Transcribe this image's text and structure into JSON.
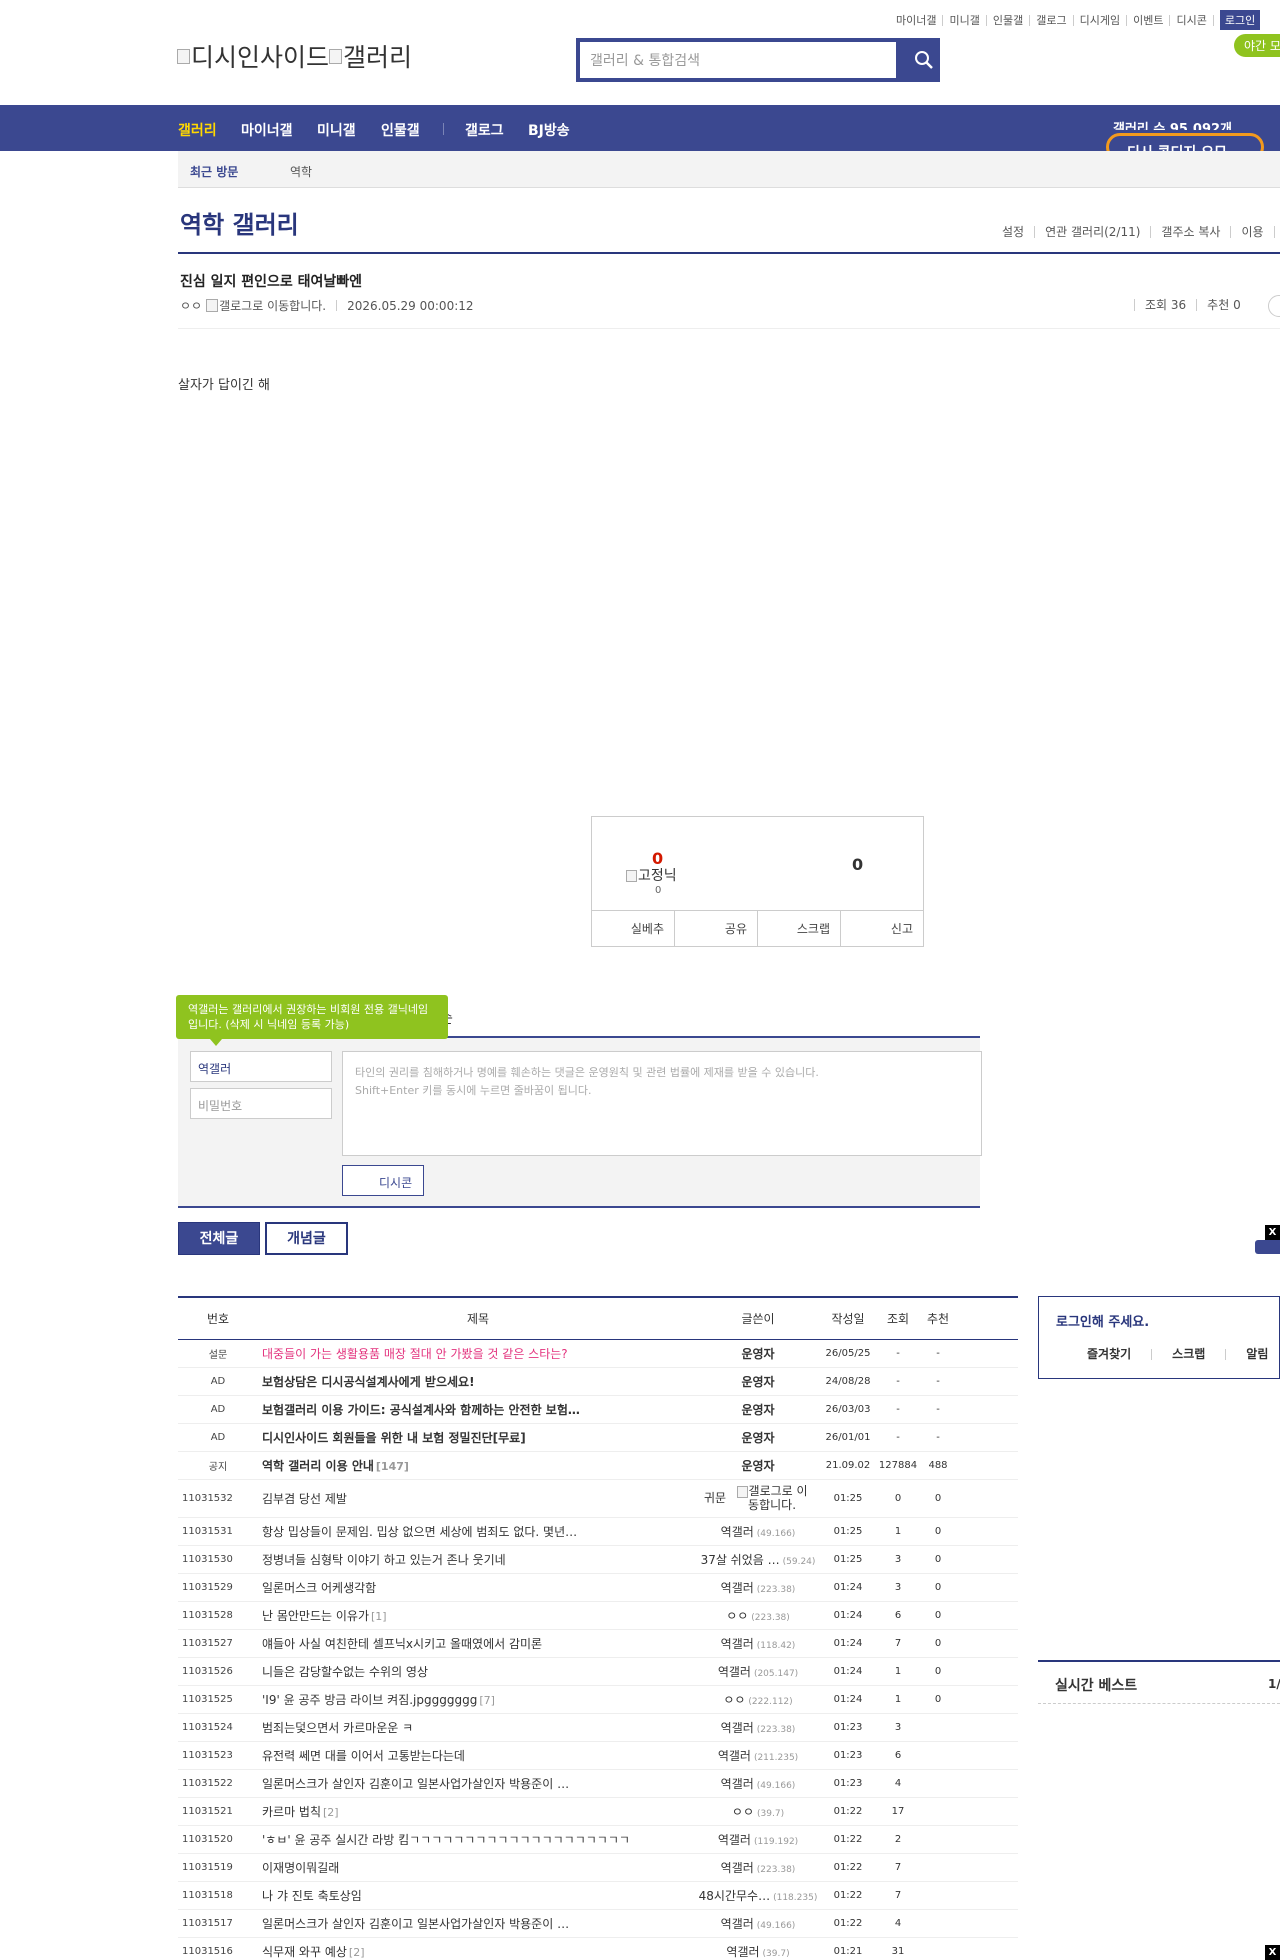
{
  "top_util": [
    "마이너갤",
    "미니갤",
    "인물갤",
    "갤로그",
    "디시게임",
    "이벤트",
    "디시콘"
  ],
  "login_label": "로그인",
  "night_mode": "야간 모",
  "logo": {
    "part1": "디시인사이드",
    "part2": "갤러리"
  },
  "search": {
    "placeholder": "갤러리 & 통합검색"
  },
  "gnb": {
    "items": [
      "갤러리",
      "마이너갤",
      "미니갤",
      "인물갤",
      "갤로그",
      "BJ방송"
    ],
    "gallery_count": "갤러리 수 95,092개",
    "dc_cook": "디시 콘디지 요모"
  },
  "recent": {
    "label": "최근 방문",
    "item": "역학"
  },
  "gallery": {
    "title": "역학 갤러리",
    "links": [
      "설정",
      "연관 갤러리(2/11)",
      "갤주소 복사",
      "이용"
    ]
  },
  "post": {
    "title": "진심 일지 편인으로 태여날빠엔",
    "author": "ㅇㅇ",
    "author_img_alt": "갤로그로 이동합니다.",
    "date": "2026.05.29 00:00:12",
    "views": "조회 36",
    "recommends": "추천 0",
    "body": "살자가 답이긴 해"
  },
  "rec_box": {
    "up": "0",
    "fix_alt": "고정닉",
    "fix_count": "0",
    "down": "0",
    "buttons": [
      "실베추",
      "공유",
      "스크랩",
      "신고"
    ]
  },
  "comment": {
    "tooltip": "역갤러는 갤러리에서 권장하는 비회원 전용 갤닉네임입니다. (삭제 시 닉네임 등록 가능)",
    "order_label": "순",
    "nick": "역갤러",
    "pw_placeholder": "비밀번호",
    "text_line1": "타인의 권리를 침해하거나 명예를 훼손하는 댓글은 운영원칙 및 관련 법률에 제재를 받을 수 있습니다.",
    "text_line2": "Shift+Enter 키를 동시에 누르면 줄바꿈이 됩니다.",
    "dccon": "디시콘"
  },
  "tabs": {
    "all": "전체글",
    "concept": "개념글"
  },
  "float_close": "X",
  "table": {
    "headers": [
      "번호",
      "제목",
      "글쓴이",
      "작성일",
      "조회",
      "추천"
    ],
    "rows": [
      {
        "num": "설문",
        "title": "대중들이 가는 생활용품 매장 절대 안 가봤을 것 같은 스타는?",
        "reply": "",
        "writer": "운영자",
        "ip": "",
        "date": "26/05/25",
        "view": "-",
        "rec": "-",
        "style": "pink"
      },
      {
        "num": "AD",
        "title": "보험상담은 디시공식설계사에게 받으세요!",
        "reply": "",
        "writer": "운영자",
        "ip": "",
        "date": "24/08/28",
        "view": "-",
        "rec": "-",
        "style": "bold"
      },
      {
        "num": "AD",
        "title": "보험갤러리 이용 가이드: 공식설계사와 함께하는 안전한 보험…",
        "reply": "",
        "writer": "운영자",
        "ip": "",
        "date": "26/03/03",
        "view": "-",
        "rec": "-",
        "style": "bold"
      },
      {
        "num": "AD",
        "title": "디시인사이드 회원들을 위한 내 보험 정밀진단[무료]",
        "reply": "",
        "writer": "운영자",
        "ip": "",
        "date": "26/01/01",
        "view": "-",
        "rec": "-",
        "style": "bold"
      },
      {
        "num": "공지",
        "title": "역학 갤러리 이용 안내",
        "reply": "[147]",
        "writer": "운영자",
        "ip": "",
        "date": "21.09.02",
        "view": "127884",
        "rec": "488",
        "style": "bold"
      },
      {
        "num": "11031532",
        "title": "김부겸 당선 제발",
        "reply": "",
        "writer": "귀문",
        "ip": "",
        "writer_img": "갤로그로 이동합니다.",
        "date": "01:25",
        "view": "0",
        "rec": "0",
        "style": ""
      },
      {
        "num": "11031531",
        "title": "항상 밉상들이 문제임. 밉상 없으면 세상에 범죄도 없다. 몇년…",
        "reply": "",
        "writer": "역갤러",
        "ip": "(49.166)",
        "date": "01:25",
        "view": "1",
        "rec": "0",
        "style": ""
      },
      {
        "num": "11031530",
        "title": "정병녀들 심형탁 이야기 하고 있는거 존나 웃기네",
        "reply": "",
        "writer": "37살 쉬었음 …",
        "ip": "(59.24)",
        "date": "01:25",
        "view": "3",
        "rec": "0",
        "style": ""
      },
      {
        "num": "11031529",
        "title": "일론머스크 어케생각함",
        "reply": "",
        "writer": "역갤러",
        "ip": "(223.38)",
        "date": "01:24",
        "view": "3",
        "rec": "0",
        "style": ""
      },
      {
        "num": "11031528",
        "title": "난 몸안만드는 이유가",
        "reply": "[1]",
        "writer": "ㅇㅇ",
        "ip": "(223.38)",
        "date": "01:24",
        "view": "6",
        "rec": "0",
        "style": ""
      },
      {
        "num": "11031527",
        "title": "얘들아 사실 여친한테 셀프닉x시키고 올때였에서 감미론",
        "reply": "",
        "writer": "역갤러",
        "ip": "(118.42)",
        "date": "01:24",
        "view": "7",
        "rec": "0",
        "style": ""
      },
      {
        "num": "11031526",
        "title": "니들은 감당할수없는 수위의 영상",
        "reply": "",
        "writer": "역갤러",
        "ip": "(205.147)",
        "date": "01:24",
        "view": "1",
        "rec": "0",
        "style": ""
      },
      {
        "num": "11031525",
        "title": "'I9' 윤 공주 방금 라이브 켜짐.jpggggggg",
        "reply": "[7]",
        "writer": "ㅇㅇ",
        "ip": "(222.112)",
        "date": "01:24",
        "view": "1",
        "rec": "0",
        "style": ""
      },
      {
        "num": "11031524",
        "title": "범죄는덫으면서 카르마운운 ㅋ",
        "reply": "",
        "writer": "역갤러",
        "ip": "(223.38)",
        "date": "01:23",
        "view": "3",
        "rec": "",
        "style": ""
      },
      {
        "num": "11031523",
        "title": "유전력 쎄면 대를 이어서 고통받는다는데",
        "reply": "",
        "writer": "역갤러",
        "ip": "(211.235)",
        "date": "01:23",
        "view": "6",
        "rec": "",
        "style": ""
      },
      {
        "num": "11031522",
        "title": "일론머스크가 살인자 김훈이고 일본사업가살인자 박용준이 …",
        "reply": "",
        "writer": "역갤러",
        "ip": "(49.166)",
        "date": "01:23",
        "view": "4",
        "rec": "",
        "style": ""
      },
      {
        "num": "11031521",
        "title": "카르마 법칙",
        "reply": "[2]",
        "writer": "ㅇㅇ",
        "ip": "(39.7)",
        "date": "01:22",
        "view": "17",
        "rec": "",
        "style": ""
      },
      {
        "num": "11031520",
        "title": "'ㅎㅂ' 윤 공주 실시간 라방 킴ㄱㄱㄱㄱㄱㄱㄱㄱㄱㄱㄱㄱㄱㄱㄱㄱㄱㄱㄱㄱ",
        "reply": "",
        "writer": "역갤러",
        "ip": "(119.192)",
        "date": "01:22",
        "view": "2",
        "rec": "",
        "style": ""
      },
      {
        "num": "11031519",
        "title": "이재명이뭐길래",
        "reply": "",
        "writer": "역갤러",
        "ip": "(223.38)",
        "date": "01:22",
        "view": "7",
        "rec": "",
        "style": ""
      },
      {
        "num": "11031518",
        "title": "나 갸 진토 축토상임",
        "reply": "",
        "writer": "48시간무수…",
        "ip": "(118.235)",
        "date": "01:22",
        "view": "7",
        "rec": "",
        "style": ""
      },
      {
        "num": "11031517",
        "title": "일론머스크가 살인자 김훈이고 일본사업가살인자 박용준이 …",
        "reply": "",
        "writer": "역갤러",
        "ip": "(49.166)",
        "date": "01:22",
        "view": "4",
        "rec": "",
        "style": ""
      },
      {
        "num": "11031516",
        "title": "식무재 와꾸 예상",
        "reply": "[2]",
        "writer": "역갤러",
        "ip": "(39.7)",
        "date": "01:21",
        "view": "31",
        "rec": "",
        "style": ""
      }
    ]
  },
  "sidebar": {
    "login_title": "로그인해 주세요.",
    "login_links": [
      "즐겨찾기",
      "스크랩",
      "알림"
    ],
    "best_title": "실시간 베스트",
    "best_page": "1/"
  }
}
